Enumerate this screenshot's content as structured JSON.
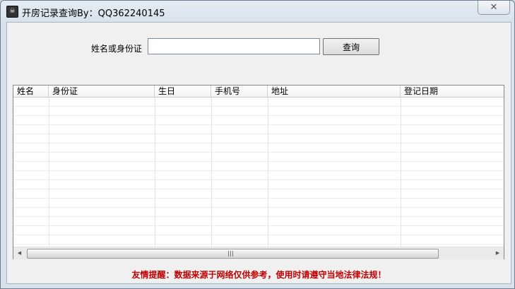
{
  "window": {
    "title": "开房记录查询By：QQ362240145",
    "app_icon": "skull-icon",
    "close_symbol": "✕"
  },
  "search": {
    "label": "姓名或身份证",
    "value": "",
    "placeholder": "",
    "button_label": "查询"
  },
  "table": {
    "columns": [
      "姓名",
      "身份证",
      "生日",
      "手机号",
      "地址",
      "登记日期"
    ],
    "rows": []
  },
  "scrollbar": {
    "left_arrow": "◀",
    "right_arrow": "▶"
  },
  "notice": "友情提醒：数据来源于网络仅供参考，使用时请遵守当地法律法规！"
}
